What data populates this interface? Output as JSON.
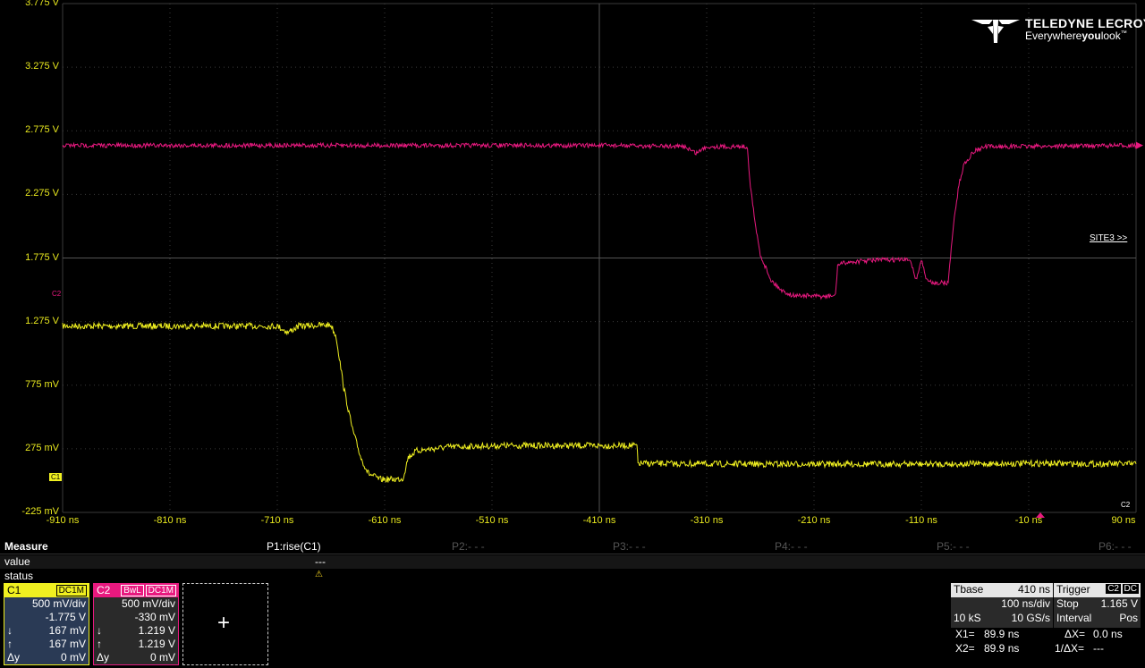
{
  "brand": {
    "name": "TELEDYNE LECROY",
    "tagline_pre": "Everywhere",
    "tagline_bold": "you",
    "tagline_post": "look",
    "trademark": "™"
  },
  "axes": {
    "y_labels": [
      "3.775 V",
      "3.275 V",
      "2.775 V",
      "2.275 V",
      "1.775 V",
      "1.275 V",
      "775 mV",
      "275 mV",
      "-225 mV"
    ],
    "x_labels": [
      "-910 ns",
      "-810 ns",
      "-710 ns",
      "-610 ns",
      "-510 ns",
      "-410 ns",
      "-310 ns",
      "-210 ns",
      "-110 ns",
      "-10 ns",
      "90 ns"
    ]
  },
  "site_link": "SITE3 >>",
  "markers": {
    "c1": "C1",
    "c2": "C2",
    "c2_bottom": "C2"
  },
  "colors": {
    "c1": "#f0f020",
    "c2": "#e8197f",
    "grid": "#3a3a3a"
  },
  "chart_data": {
    "type": "line",
    "xlabel": "",
    "ylabel": "",
    "xlim": [
      -910,
      90
    ],
    "ylim": [
      -225,
      3775
    ],
    "grid": true,
    "series": [
      {
        "name": "C1",
        "color": "#f0f020",
        "x": [
          -910,
          -710,
          -700,
          -690,
          -660,
          -655,
          -648,
          -640,
          -632,
          -625,
          -620,
          -615,
          -600,
          -593,
          -588,
          -580,
          -550,
          -500,
          -450,
          -375,
          -374,
          -300,
          -200,
          -100,
          0,
          90
        ],
        "y": [
          1240,
          1240,
          1190,
          1240,
          1250,
          1150,
          750,
          430,
          200,
          80,
          60,
          35,
          35,
          40,
          210,
          260,
          290,
          300,
          300,
          300,
          160,
          155,
          155,
          155,
          160,
          155
        ]
      },
      {
        "name": "C2",
        "color": "#e8197f",
        "x": [
          -910,
          -600,
          -400,
          -330,
          -320,
          -310,
          -272,
          -270,
          -265,
          -260,
          -250,
          -240,
          -230,
          -220,
          -200,
          -190,
          -188,
          -180,
          -150,
          -120,
          -115,
          -110,
          -105,
          -100,
          -85,
          -80,
          -75,
          -70,
          -60,
          -50,
          90
        ],
        "y": [
          2660,
          2660,
          2660,
          2650,
          2600,
          2650,
          2650,
          2400,
          2050,
          1800,
          1600,
          1520,
          1480,
          1480,
          1470,
          1480,
          1720,
          1740,
          1760,
          1760,
          1600,
          1760,
          1600,
          1580,
          1580,
          2050,
          2350,
          2520,
          2620,
          2650,
          2660
        ]
      }
    ]
  },
  "measure": {
    "title": "Measure",
    "row_value": "value",
    "row_status": "status",
    "params": [
      {
        "name": "P1:rise(C1)",
        "value": "---",
        "status": "⚠"
      },
      {
        "name": "P2:- - -"
      },
      {
        "name": "P3:- - -"
      },
      {
        "name": "P4:- - -"
      },
      {
        "name": "P5:- - -"
      },
      {
        "name": "P6:- - -"
      }
    ]
  },
  "channels": [
    {
      "name": "C1",
      "tags": [
        "DC1M"
      ],
      "vdiv": "500 mV/div",
      "offset": "-1.775 V",
      "down": "167 mV",
      "up": "167 mV",
      "dy_label": "Δy",
      "dy": "0 mV"
    },
    {
      "name": "C2",
      "tags": [
        "BwL",
        "DC1M"
      ],
      "vdiv": "500 mV/div",
      "offset": "-330 mV",
      "down": "1.219 V",
      "up": "1.219 V",
      "dy_label": "Δy",
      "dy": "0 mV"
    }
  ],
  "timebase": {
    "label": "Tbase",
    "value": "410 ns",
    "tdiv": "100 ns/div",
    "samples": "10 kS",
    "rate": "10 GS/s"
  },
  "trigger": {
    "label": "Trigger",
    "channel": "C2",
    "coupling": "DC",
    "mode": "Stop",
    "level": "1.165 V",
    "type": "Interval",
    "slope": "Pos"
  },
  "cursors": {
    "x1_label": "X1=",
    "x1": "89.9 ns",
    "dx_label": "ΔX=",
    "dx": "0.0 ns",
    "x2_label": "X2=",
    "x2": "89.9 ns",
    "inv_label": "1/ΔX=",
    "inv": "---"
  }
}
